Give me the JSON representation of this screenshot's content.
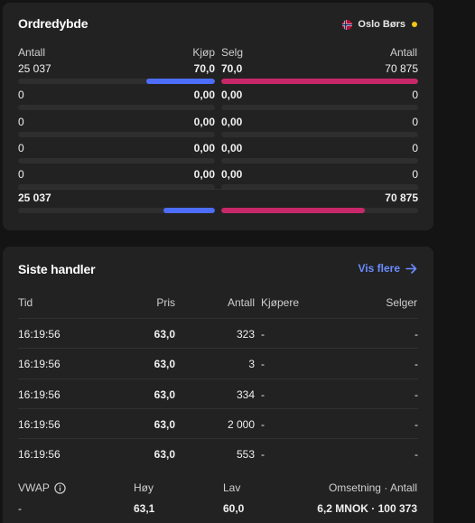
{
  "order_depth": {
    "title": "Ordredybde",
    "exchange": "Oslo Børs",
    "colors": {
      "buy": "#4d6dfb",
      "sell": "#c8286a",
      "status_dot": "#f5c518"
    },
    "headers": {
      "bid_qty": "Antall",
      "bid_price": "Kjøp",
      "ask_price": "Selg",
      "ask_qty": "Antall"
    },
    "rows": [
      {
        "bid_qty": "25 037",
        "bid_price": "70,0",
        "ask_price": "70,0",
        "ask_qty": "70 875",
        "bid_fill": 0.35,
        "ask_fill": 1.0
      },
      {
        "bid_qty": "0",
        "bid_price": "0,00",
        "ask_price": "0,00",
        "ask_qty": "0",
        "bid_fill": 0,
        "ask_fill": 0
      },
      {
        "bid_qty": "0",
        "bid_price": "0,00",
        "ask_price": "0,00",
        "ask_qty": "0",
        "bid_fill": 0,
        "ask_fill": 0
      },
      {
        "bid_qty": "0",
        "bid_price": "0,00",
        "ask_price": "0,00",
        "ask_qty": "0",
        "bid_fill": 0,
        "ask_fill": 0
      },
      {
        "bid_qty": "0",
        "bid_price": "0,00",
        "ask_price": "0,00",
        "ask_qty": "0",
        "bid_fill": 0,
        "ask_fill": 0
      }
    ],
    "totals": {
      "bid_qty": "25 037",
      "ask_qty": "70 875",
      "bid_fill": 0.26,
      "ask_fill": 0.73
    }
  },
  "trades": {
    "title": "Siste handler",
    "show_more": "Vis flere",
    "columns": {
      "time": "Tid",
      "price": "Pris",
      "qty": "Antall",
      "buyer": "Kjøpere",
      "seller": "Selger"
    },
    "rows": [
      {
        "time": "16:19:56",
        "price": "63,0",
        "qty": "323",
        "buyer": "-",
        "seller": "-"
      },
      {
        "time": "16:19:56",
        "price": "63,0",
        "qty": "3",
        "buyer": "-",
        "seller": "-"
      },
      {
        "time": "16:19:56",
        "price": "63,0",
        "qty": "334",
        "buyer": "-",
        "seller": "-"
      },
      {
        "time": "16:19:56",
        "price": "63,0",
        "qty": "2 000",
        "buyer": "-",
        "seller": "-"
      },
      {
        "time": "16:19:56",
        "price": "63,0",
        "qty": "553",
        "buyer": "-",
        "seller": "-"
      }
    ],
    "footer": {
      "vwap_label": "VWAP",
      "vwap_value": "-",
      "high_label": "Høy",
      "high_value": "63,1",
      "low_label": "Lav",
      "low_value": "60,0",
      "turnover_label": "Omsetning · Antall",
      "turnover_value": "6,2 MNOK · 100 373"
    }
  }
}
